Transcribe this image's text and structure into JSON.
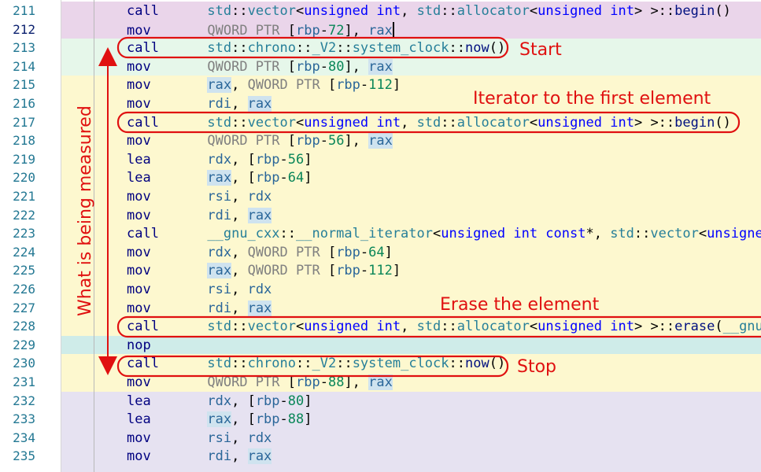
{
  "colors": {
    "band_pink": "#ead5ea",
    "band_green": "#e6f7ea",
    "band_yellow": "#fdf8cf",
    "band_teal": "#cfece9",
    "band_lavender": "#e6e2f1",
    "annotation_red": "#e01010"
  },
  "lines": [
    {
      "num": "211",
      "band": "band_pink",
      "tokens": [
        [
          "op",
          "call"
        ],
        [
          "t",
          "      "
        ],
        [
          "ns",
          "std"
        ],
        [
          "t",
          "::"
        ],
        [
          "ty",
          "vector"
        ],
        [
          "t",
          "<"
        ],
        [
          "kw",
          "unsigned int"
        ],
        [
          "t",
          ", "
        ],
        [
          "ns",
          "std"
        ],
        [
          "t",
          "::"
        ],
        [
          "ty",
          "allocator"
        ],
        [
          "t",
          "<"
        ],
        [
          "kw",
          "unsigned int"
        ],
        [
          "t",
          "> >::"
        ],
        [
          "sym",
          "begin"
        ],
        [
          "t",
          "()"
        ]
      ]
    },
    {
      "num": "212",
      "band": "band_pink",
      "current": true,
      "tokens": [
        [
          "op",
          "mov"
        ],
        [
          "t",
          "       "
        ],
        [
          "ptr",
          "QWORD PTR"
        ],
        [
          "t",
          " ["
        ],
        [
          "reg",
          "rbp"
        ],
        [
          "t",
          "-"
        ],
        [
          "nm",
          "72"
        ],
        [
          "t",
          "], "
        ],
        [
          "reg",
          "rax"
        ],
        [
          "cursor",
          ""
        ]
      ]
    },
    {
      "num": "213",
      "band": "band_green",
      "tokens": [
        [
          "op",
          "call"
        ],
        [
          "t",
          "      "
        ],
        [
          "ns",
          "std"
        ],
        [
          "t",
          "::"
        ],
        [
          "ns",
          "chrono"
        ],
        [
          "t",
          "::"
        ],
        [
          "ns",
          "_V2"
        ],
        [
          "t",
          "::"
        ],
        [
          "ty",
          "system_clock"
        ],
        [
          "t",
          "::"
        ],
        [
          "sym",
          "now"
        ],
        [
          "t",
          "()"
        ]
      ]
    },
    {
      "num": "214",
      "band": "band_green",
      "tokens": [
        [
          "op",
          "mov"
        ],
        [
          "t",
          "       "
        ],
        [
          "ptr",
          "QWORD PTR"
        ],
        [
          "t",
          " ["
        ],
        [
          "reg",
          "rbp"
        ],
        [
          "t",
          "-"
        ],
        [
          "nm",
          "80"
        ],
        [
          "t",
          "], "
        ],
        [
          "regh",
          "rax"
        ]
      ]
    },
    {
      "num": "215",
      "band": "band_yellow",
      "tokens": [
        [
          "op",
          "mov"
        ],
        [
          "t",
          "       "
        ],
        [
          "regh",
          "rax"
        ],
        [
          "t",
          ", "
        ],
        [
          "ptr",
          "QWORD PTR"
        ],
        [
          "t",
          " ["
        ],
        [
          "reg",
          "rbp"
        ],
        [
          "t",
          "-"
        ],
        [
          "nm",
          "112"
        ],
        [
          "t",
          "]"
        ]
      ]
    },
    {
      "num": "216",
      "band": "band_yellow",
      "tokens": [
        [
          "op",
          "mov"
        ],
        [
          "t",
          "       "
        ],
        [
          "reg",
          "rdi"
        ],
        [
          "t",
          ", "
        ],
        [
          "regh",
          "rax"
        ]
      ]
    },
    {
      "num": "217",
      "band": "band_yellow",
      "tokens": [
        [
          "op",
          "call"
        ],
        [
          "t",
          "      "
        ],
        [
          "ns",
          "std"
        ],
        [
          "t",
          "::"
        ],
        [
          "ty",
          "vector"
        ],
        [
          "t",
          "<"
        ],
        [
          "kw",
          "unsigned int"
        ],
        [
          "t",
          ", "
        ],
        [
          "ns",
          "std"
        ],
        [
          "t",
          "::"
        ],
        [
          "ty",
          "allocator"
        ],
        [
          "t",
          "<"
        ],
        [
          "kw",
          "unsigned int"
        ],
        [
          "t",
          "> >::"
        ],
        [
          "sym",
          "begin"
        ],
        [
          "t",
          "()"
        ]
      ]
    },
    {
      "num": "218",
      "band": "band_yellow",
      "tokens": [
        [
          "op",
          "mov"
        ],
        [
          "t",
          "       "
        ],
        [
          "ptr",
          "QWORD PTR"
        ],
        [
          "t",
          " ["
        ],
        [
          "reg",
          "rbp"
        ],
        [
          "t",
          "-"
        ],
        [
          "nm",
          "56"
        ],
        [
          "t",
          "], "
        ],
        [
          "regh",
          "rax"
        ]
      ]
    },
    {
      "num": "219",
      "band": "band_yellow",
      "tokens": [
        [
          "op",
          "lea"
        ],
        [
          "t",
          "       "
        ],
        [
          "reg",
          "rdx"
        ],
        [
          "t",
          ", ["
        ],
        [
          "reg",
          "rbp"
        ],
        [
          "t",
          "-"
        ],
        [
          "nm",
          "56"
        ],
        [
          "t",
          "]"
        ]
      ]
    },
    {
      "num": "220",
      "band": "band_yellow",
      "tokens": [
        [
          "op",
          "lea"
        ],
        [
          "t",
          "       "
        ],
        [
          "regh",
          "rax"
        ],
        [
          "t",
          ", ["
        ],
        [
          "reg",
          "rbp"
        ],
        [
          "t",
          "-"
        ],
        [
          "nm",
          "64"
        ],
        [
          "t",
          "]"
        ]
      ]
    },
    {
      "num": "221",
      "band": "band_yellow",
      "tokens": [
        [
          "op",
          "mov"
        ],
        [
          "t",
          "       "
        ],
        [
          "reg",
          "rsi"
        ],
        [
          "t",
          ", "
        ],
        [
          "reg",
          "rdx"
        ]
      ]
    },
    {
      "num": "222",
      "band": "band_yellow",
      "tokens": [
        [
          "op",
          "mov"
        ],
        [
          "t",
          "       "
        ],
        [
          "reg",
          "rdi"
        ],
        [
          "t",
          ", "
        ],
        [
          "regh",
          "rax"
        ]
      ]
    },
    {
      "num": "223",
      "band": "band_yellow",
      "tokens": [
        [
          "op",
          "call"
        ],
        [
          "t",
          "      "
        ],
        [
          "ns",
          "__gnu_cxx"
        ],
        [
          "t",
          "::"
        ],
        [
          "ty",
          "__normal_iterator"
        ],
        [
          "t",
          "<"
        ],
        [
          "kw",
          "unsigned int const"
        ],
        [
          "t",
          "*, "
        ],
        [
          "ns",
          "std"
        ],
        [
          "t",
          "::"
        ],
        [
          "ty",
          "vector"
        ],
        [
          "t",
          "<"
        ],
        [
          "kw",
          "unsigned int"
        ],
        [
          "t",
          "> >"
        ]
      ]
    },
    {
      "num": "224",
      "band": "band_yellow",
      "tokens": [
        [
          "op",
          "mov"
        ],
        [
          "t",
          "       "
        ],
        [
          "reg",
          "rdx"
        ],
        [
          "t",
          ", "
        ],
        [
          "ptr",
          "QWORD PTR"
        ],
        [
          "t",
          " ["
        ],
        [
          "reg",
          "rbp"
        ],
        [
          "t",
          "-"
        ],
        [
          "nm",
          "64"
        ],
        [
          "t",
          "]"
        ]
      ]
    },
    {
      "num": "225",
      "band": "band_yellow",
      "tokens": [
        [
          "op",
          "mov"
        ],
        [
          "t",
          "       "
        ],
        [
          "regh",
          "rax"
        ],
        [
          "t",
          ", "
        ],
        [
          "ptr",
          "QWORD PTR"
        ],
        [
          "t",
          " ["
        ],
        [
          "reg",
          "rbp"
        ],
        [
          "t",
          "-"
        ],
        [
          "nm",
          "112"
        ],
        [
          "t",
          "]"
        ]
      ]
    },
    {
      "num": "226",
      "band": "band_yellow",
      "tokens": [
        [
          "op",
          "mov"
        ],
        [
          "t",
          "       "
        ],
        [
          "reg",
          "rsi"
        ],
        [
          "t",
          ", "
        ],
        [
          "reg",
          "rdx"
        ]
      ]
    },
    {
      "num": "227",
      "band": "band_yellow",
      "tokens": [
        [
          "op",
          "mov"
        ],
        [
          "t",
          "       "
        ],
        [
          "reg",
          "rdi"
        ],
        [
          "t",
          ", "
        ],
        [
          "regh",
          "rax"
        ]
      ]
    },
    {
      "num": "228",
      "band": "band_yellow",
      "tokens": [
        [
          "op",
          "call"
        ],
        [
          "t",
          "      "
        ],
        [
          "ns",
          "std"
        ],
        [
          "t",
          "::"
        ],
        [
          "ty",
          "vector"
        ],
        [
          "t",
          "<"
        ],
        [
          "kw",
          "unsigned int"
        ],
        [
          "t",
          ", "
        ],
        [
          "ns",
          "std"
        ],
        [
          "t",
          "::"
        ],
        [
          "ty",
          "allocator"
        ],
        [
          "t",
          "<"
        ],
        [
          "kw",
          "unsigned int"
        ],
        [
          "t",
          "> >::"
        ],
        [
          "sym",
          "erase"
        ],
        [
          "t",
          "("
        ],
        [
          "ns",
          "__gnu_cxx"
        ]
      ]
    },
    {
      "num": "229",
      "band": "band_teal",
      "tokens": [
        [
          "op",
          "nop"
        ]
      ]
    },
    {
      "num": "230",
      "band": "band_yellow",
      "tokens": [
        [
          "op",
          "call"
        ],
        [
          "t",
          "      "
        ],
        [
          "ns",
          "std"
        ],
        [
          "t",
          "::"
        ],
        [
          "ns",
          "chrono"
        ],
        [
          "t",
          "::"
        ],
        [
          "ns",
          "_V2"
        ],
        [
          "t",
          "::"
        ],
        [
          "ty",
          "system_clock"
        ],
        [
          "t",
          "::"
        ],
        [
          "sym",
          "now"
        ],
        [
          "t",
          "()"
        ]
      ]
    },
    {
      "num": "231",
      "band": "band_yellow",
      "tokens": [
        [
          "op",
          "mov"
        ],
        [
          "t",
          "       "
        ],
        [
          "ptr",
          "QWORD PTR"
        ],
        [
          "t",
          " ["
        ],
        [
          "reg",
          "rbp"
        ],
        [
          "t",
          "-"
        ],
        [
          "nm",
          "88"
        ],
        [
          "t",
          "], "
        ],
        [
          "regh",
          "rax"
        ]
      ]
    },
    {
      "num": "232",
      "band": "band_lavender",
      "tokens": [
        [
          "op",
          "lea"
        ],
        [
          "t",
          "       "
        ],
        [
          "reg",
          "rdx"
        ],
        [
          "t",
          ", ["
        ],
        [
          "reg",
          "rbp"
        ],
        [
          "t",
          "-"
        ],
        [
          "nm",
          "80"
        ],
        [
          "t",
          "]"
        ]
      ]
    },
    {
      "num": "233",
      "band": "band_lavender",
      "tokens": [
        [
          "op",
          "lea"
        ],
        [
          "t",
          "       "
        ],
        [
          "regh",
          "rax"
        ],
        [
          "t",
          ", ["
        ],
        [
          "reg",
          "rbp"
        ],
        [
          "t",
          "-"
        ],
        [
          "nm",
          "88"
        ],
        [
          "t",
          "]"
        ]
      ]
    },
    {
      "num": "234",
      "band": "band_lavender",
      "tokens": [
        [
          "op",
          "mov"
        ],
        [
          "t",
          "       "
        ],
        [
          "reg",
          "rsi"
        ],
        [
          "t",
          ", "
        ],
        [
          "reg",
          "rdx"
        ]
      ]
    },
    {
      "num": "235",
      "band": "band_lavender",
      "tokens": [
        [
          "op",
          "mov"
        ],
        [
          "t",
          "       "
        ],
        [
          "reg",
          "rdi"
        ],
        [
          "t",
          ", "
        ],
        [
          "regh",
          "rax"
        ]
      ]
    },
    {
      "num": "",
      "band": "band_lavender",
      "tokens": []
    }
  ],
  "annotations": {
    "start": "Start",
    "iterator": "Iterator to the first element",
    "erase": "Erase the element",
    "stop": "Stop",
    "measured": "What is being measured"
  }
}
